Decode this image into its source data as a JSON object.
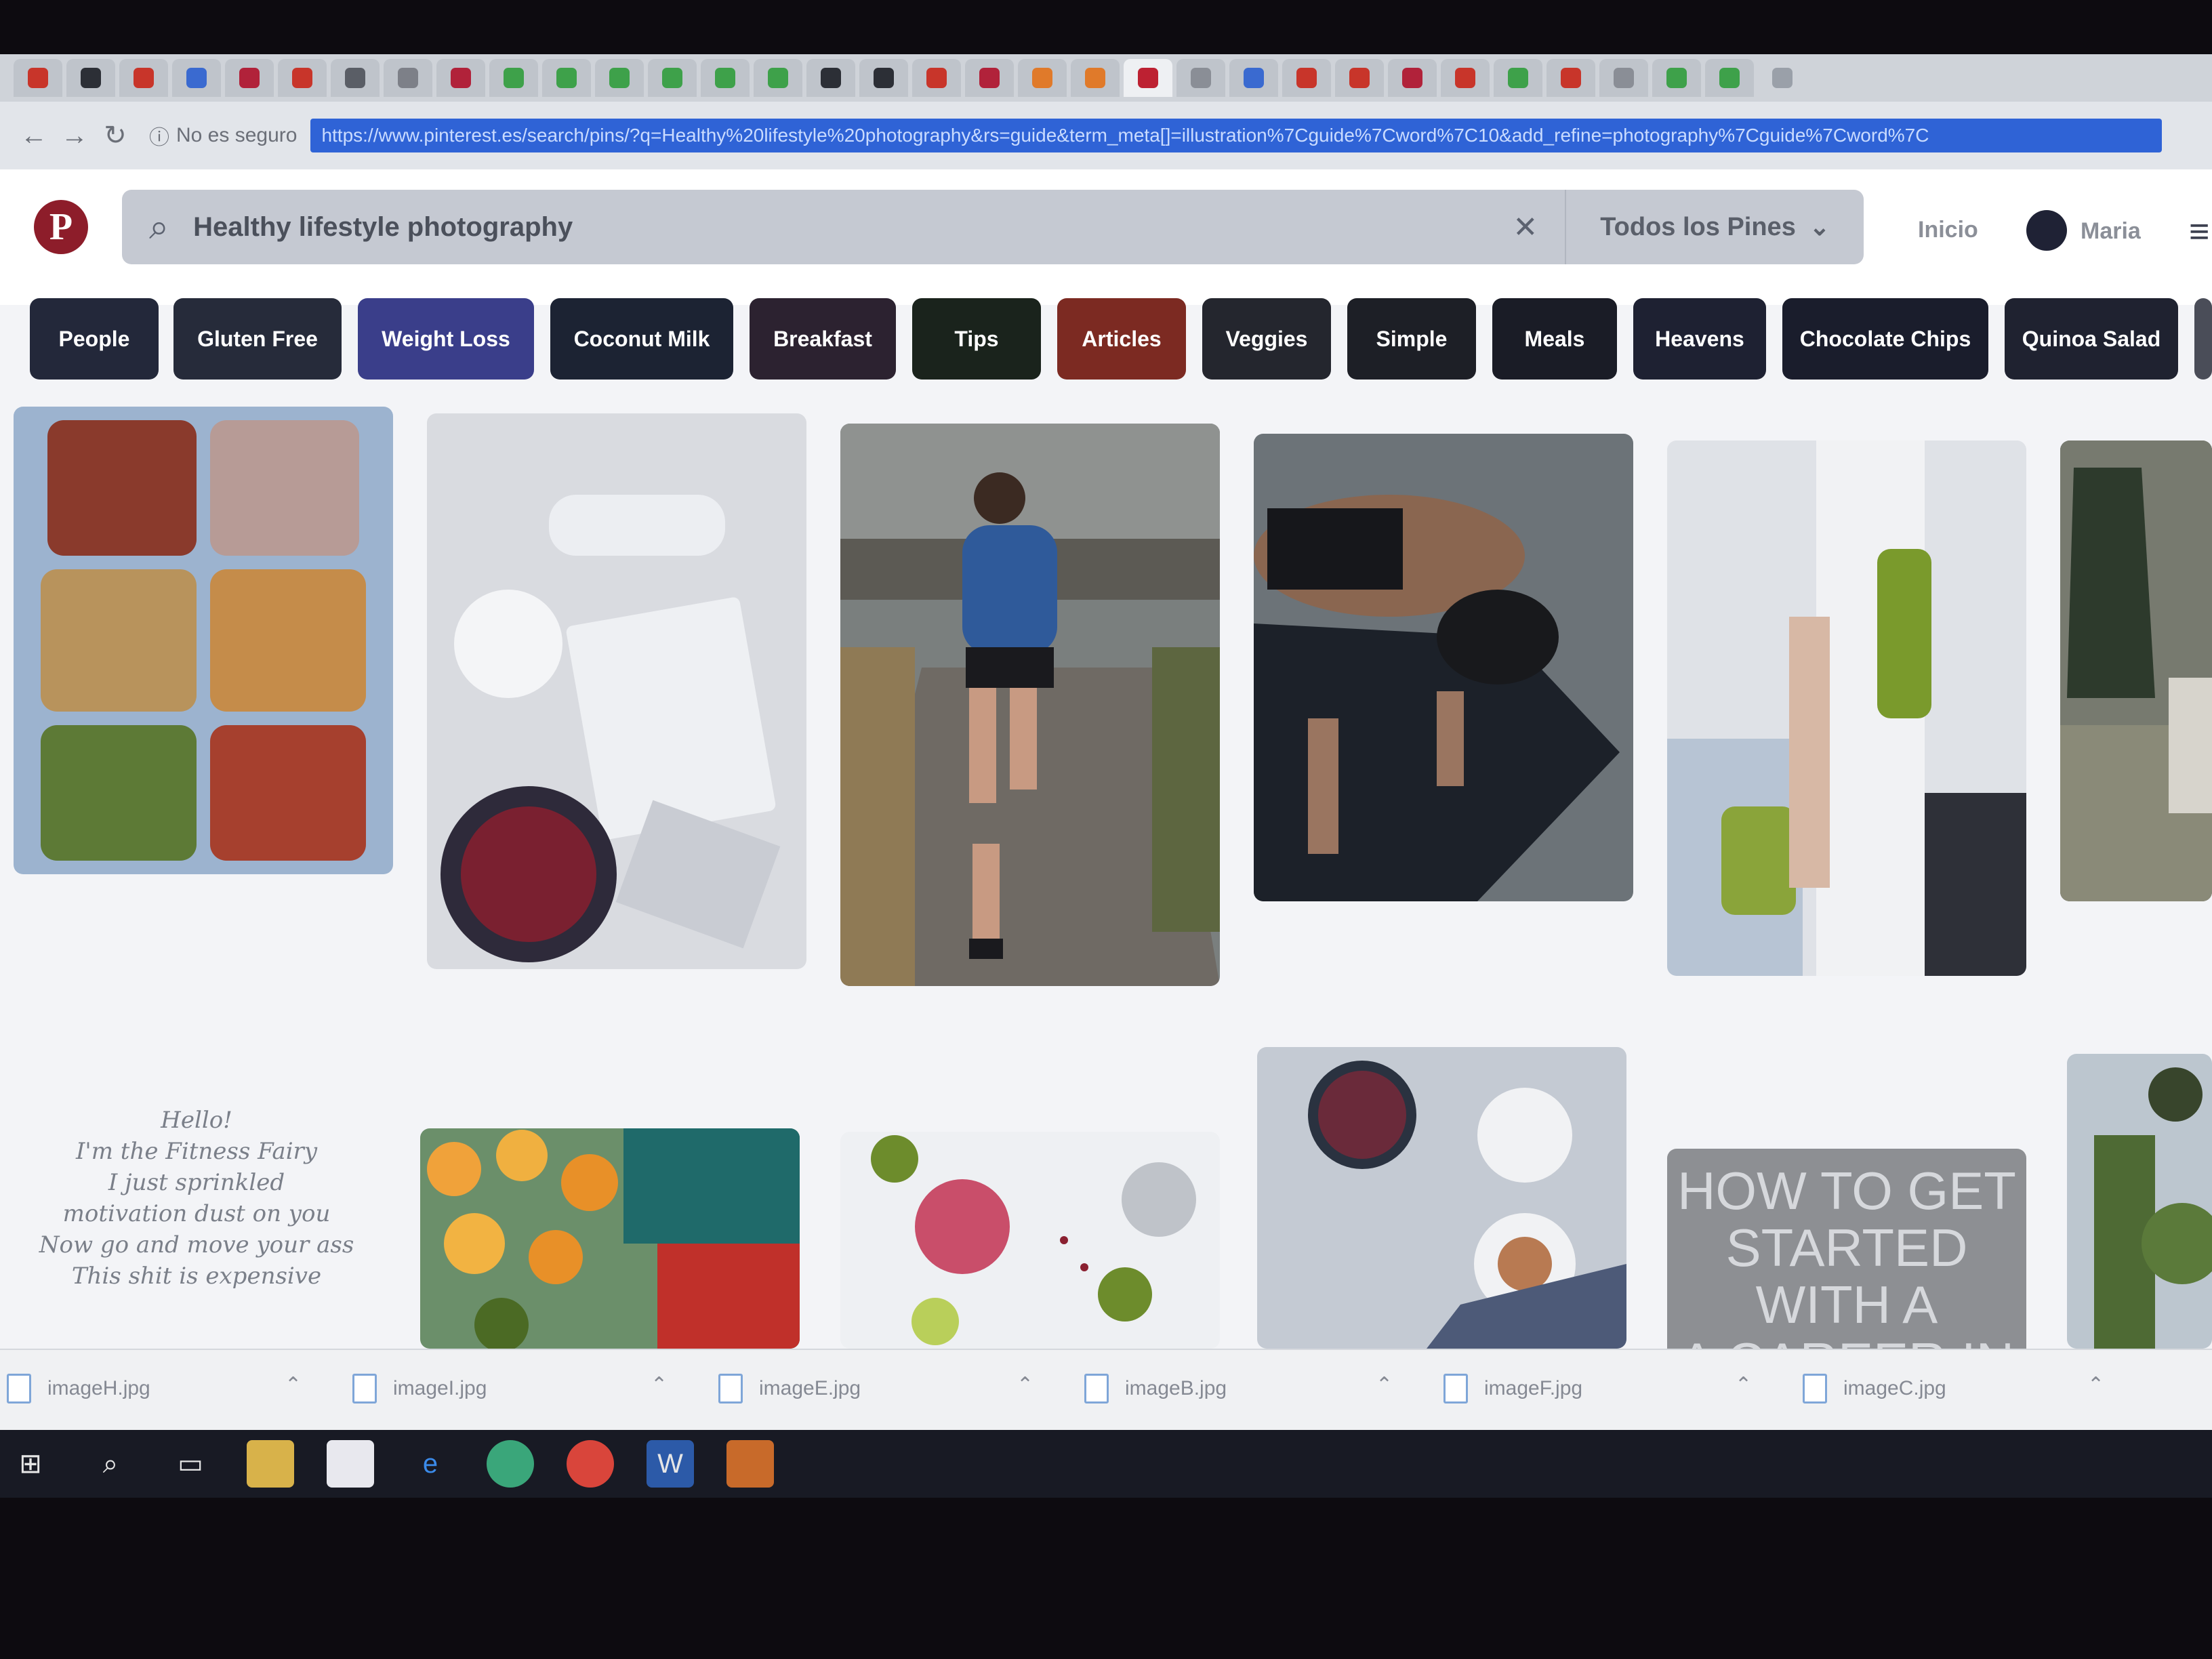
{
  "browser": {
    "security_label": "No es seguro",
    "url": "https://www.pinterest.es/search/pins/?q=Healthy%20lifestyle%20photography&rs=guide&term_meta[]=illustration%7Cguide%7Cword%7C10&add_refine=photography%7Cguide%7Cword%7C"
  },
  "header": {
    "logo": "P",
    "search_query": "Healthy lifestyle photography",
    "scope_label": "Todos los Pines",
    "home_label": "Inicio",
    "user_name": "Maria"
  },
  "guides": [
    {
      "label": "People",
      "color": "#23283a"
    },
    {
      "label": "Gluten Free",
      "color": "#262b3a"
    },
    {
      "label": "Weight Loss",
      "color": "#3a3e8a"
    },
    {
      "label": "Coconut Milk",
      "color": "#1c2333"
    },
    {
      "label": "Breakfast",
      "color": "#2c2230"
    },
    {
      "label": "Tips",
      "color": "#1a231c"
    },
    {
      "label": "Articles",
      "color": "#7c2a22"
    },
    {
      "label": "Veggies",
      "color": "#24262e"
    },
    {
      "label": "Simple",
      "color": "#1d1f26"
    },
    {
      "label": "Meals",
      "color": "#1a1c26"
    },
    {
      "label": "Heavens",
      "color": "#1e2132"
    },
    {
      "label": "Chocolate Chips",
      "color": "#1a1d2c"
    },
    {
      "label": "Quinoa Salad",
      "color": "#1f2230"
    }
  ],
  "pins": {
    "quote_lines": [
      "Hello!",
      "I'm the Fitness Fairy",
      "I just sprinkled",
      "motivation dust on you",
      "Now go and move your ass",
      "This shit is expensive"
    ],
    "article_lines": [
      "HOW TO GET",
      "STARTED",
      "WITH A",
      "A CAREER IN"
    ]
  },
  "downloads": [
    "imageH.jpg",
    "imageI.jpg",
    "imageE.jpg",
    "imageB.jpg",
    "imageF.jpg",
    "imageC.jpg"
  ]
}
